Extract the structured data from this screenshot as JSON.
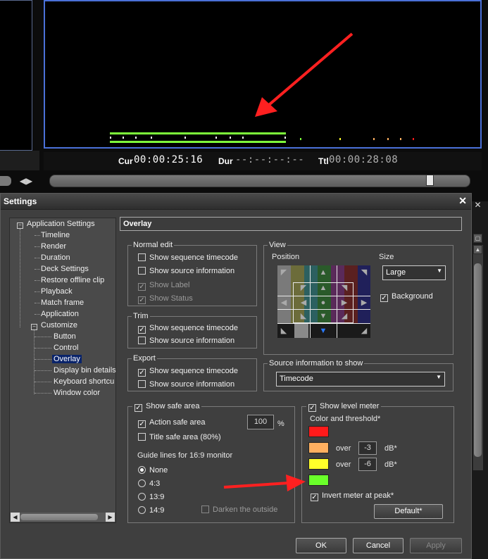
{
  "timecode": {
    "cur_label": "Cur",
    "cur_value": "00:00:25:16",
    "dur_label": "Dur",
    "dur_value": "--:--:--:--",
    "ttl_label": "Ttl",
    "ttl_value": "00:00:28:08"
  },
  "dialog": {
    "title": "Settings",
    "close": "✕",
    "ok_label": "OK",
    "cancel_label": "Cancel",
    "apply_label": "Apply"
  },
  "tree": {
    "root": "Application Settings",
    "items": [
      "Timeline",
      "Render",
      "Duration",
      "Deck Settings",
      "Restore offline clip",
      "Playback",
      "Match frame",
      "Application"
    ],
    "customize": "Customize",
    "sub_items": [
      "Button",
      "Control",
      "Overlay",
      "Display bin details",
      "Keyboard shortcut",
      "Window color"
    ]
  },
  "overlay": {
    "header": "Overlay",
    "normal_edit": {
      "label": "Normal edit",
      "seq_tc": "Show sequence timecode",
      "src_info": "Show source information",
      "show_label": "Show Label",
      "show_status": "Show Status"
    },
    "trim": {
      "label": "Trim",
      "seq_tc": "Show sequence timecode",
      "src_info": "Show source information"
    },
    "export": {
      "label": "Export",
      "seq_tc": "Show sequence timecode",
      "src_info": "Show source information"
    },
    "view": {
      "label": "View",
      "position": "Position",
      "size": "Size",
      "size_value": "Large",
      "background": "Background"
    },
    "source_info": {
      "label": "Source information to show",
      "value": "Timecode"
    },
    "safe_area": {
      "label": "Show safe area",
      "action": "Action safe area",
      "action_value": "100",
      "percent": "%",
      "title": "Title safe area (80%)",
      "guide_label": "Guide lines for 16:9 monitor",
      "none": "None",
      "r43": "4:3",
      "r139": "13:9",
      "r149": "14:9",
      "darken": "Darken the outside"
    },
    "level_meter": {
      "label": "Show level meter",
      "color_threshold": "Color and threshold*",
      "over": "over",
      "th1": "-3",
      "th2": "-6",
      "db": "dB*",
      "invert": "Invert meter at peak*",
      "default": "Default*",
      "colors": [
        "#ff1a1a",
        "#ffb060",
        "#ffff2a",
        "#6aff2a"
      ]
    }
  }
}
